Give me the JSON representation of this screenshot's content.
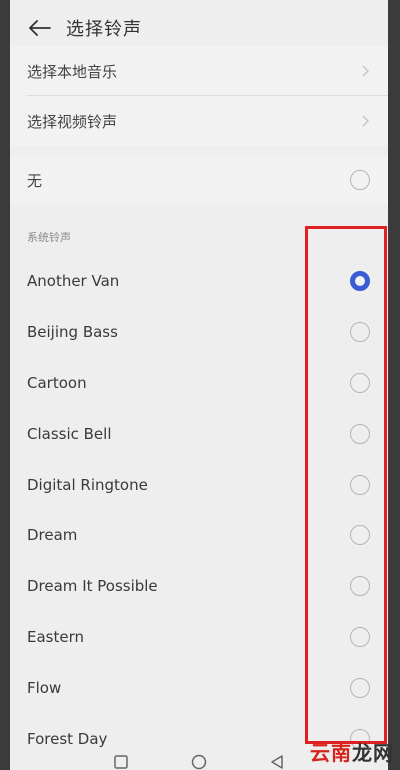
{
  "header": {
    "title": "选择铃声"
  },
  "top_menu": [
    {
      "label": "选择本地音乐"
    },
    {
      "label": "选择视频铃声"
    }
  ],
  "none_option": {
    "label": "无",
    "selected": false
  },
  "section_title": "系统铃声",
  "ringtones": [
    {
      "label": "Another Van",
      "selected": true
    },
    {
      "label": "Beijing Bass",
      "selected": false
    },
    {
      "label": "Cartoon",
      "selected": false
    },
    {
      "label": "Classic Bell",
      "selected": false
    },
    {
      "label": "Digital Ringtone",
      "selected": false
    },
    {
      "label": "Dream",
      "selected": false
    },
    {
      "label": "Dream It Possible",
      "selected": false
    },
    {
      "label": "Eastern",
      "selected": false
    },
    {
      "label": "Flow",
      "selected": false
    },
    {
      "label": "Forest Day",
      "selected": false
    }
  ],
  "watermark": {
    "part1": "云南",
    "part2": "龙网"
  },
  "colors": {
    "accent": "#3b5bd6",
    "highlight": "#e02020",
    "background": "#eeeeee"
  },
  "icons": {
    "back": "arrow-left-icon",
    "chevron": "chevron-right-icon",
    "nav_back": "triangle-back-icon",
    "nav_home": "circle-home-icon",
    "nav_recent": "square-recent-icon"
  }
}
